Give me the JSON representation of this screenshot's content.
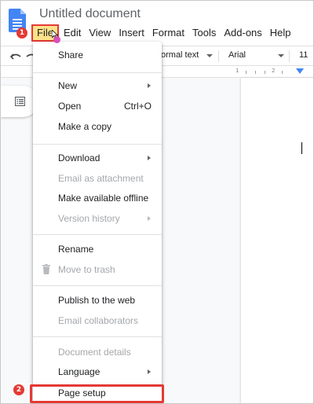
{
  "document": {
    "title": "Untitled document"
  },
  "menubar": {
    "items": [
      {
        "label": "File"
      },
      {
        "label": "Edit"
      },
      {
        "label": "View"
      },
      {
        "label": "Insert"
      },
      {
        "label": "Format"
      },
      {
        "label": "Tools"
      },
      {
        "label": "Add-ons"
      },
      {
        "label": "Help"
      }
    ]
  },
  "toolbar": {
    "style_value": "ormal text",
    "font_value": "Arial",
    "size_value": "11"
  },
  "ruler": {
    "numbers": [
      "1",
      "2"
    ]
  },
  "annotations": {
    "step1": "1",
    "step2": "2",
    "highlight_color": "#e53935",
    "file_highlight_bg": "#fde28a"
  },
  "file_menu": {
    "items": [
      {
        "label": "Share",
        "disabled": false
      },
      {
        "label": "New",
        "submenu": true,
        "disabled": false
      },
      {
        "label": "Open",
        "shortcut": "Ctrl+O",
        "disabled": false
      },
      {
        "label": "Make a copy",
        "disabled": false
      },
      {
        "label": "Download",
        "submenu": true,
        "disabled": false
      },
      {
        "label": "Email as attachment",
        "disabled": true
      },
      {
        "label": "Make available offline",
        "disabled": false
      },
      {
        "label": "Version history",
        "submenu": true,
        "disabled": true
      },
      {
        "label": "Rename",
        "disabled": false
      },
      {
        "label": "Move to trash",
        "icon": "trash-icon",
        "disabled": true
      },
      {
        "label": "Publish to the web",
        "disabled": false
      },
      {
        "label": "Email collaborators",
        "disabled": true
      },
      {
        "label": "Document details",
        "disabled": true
      },
      {
        "label": "Language",
        "submenu": true,
        "disabled": false
      },
      {
        "label": "Page setup",
        "disabled": false
      }
    ]
  }
}
